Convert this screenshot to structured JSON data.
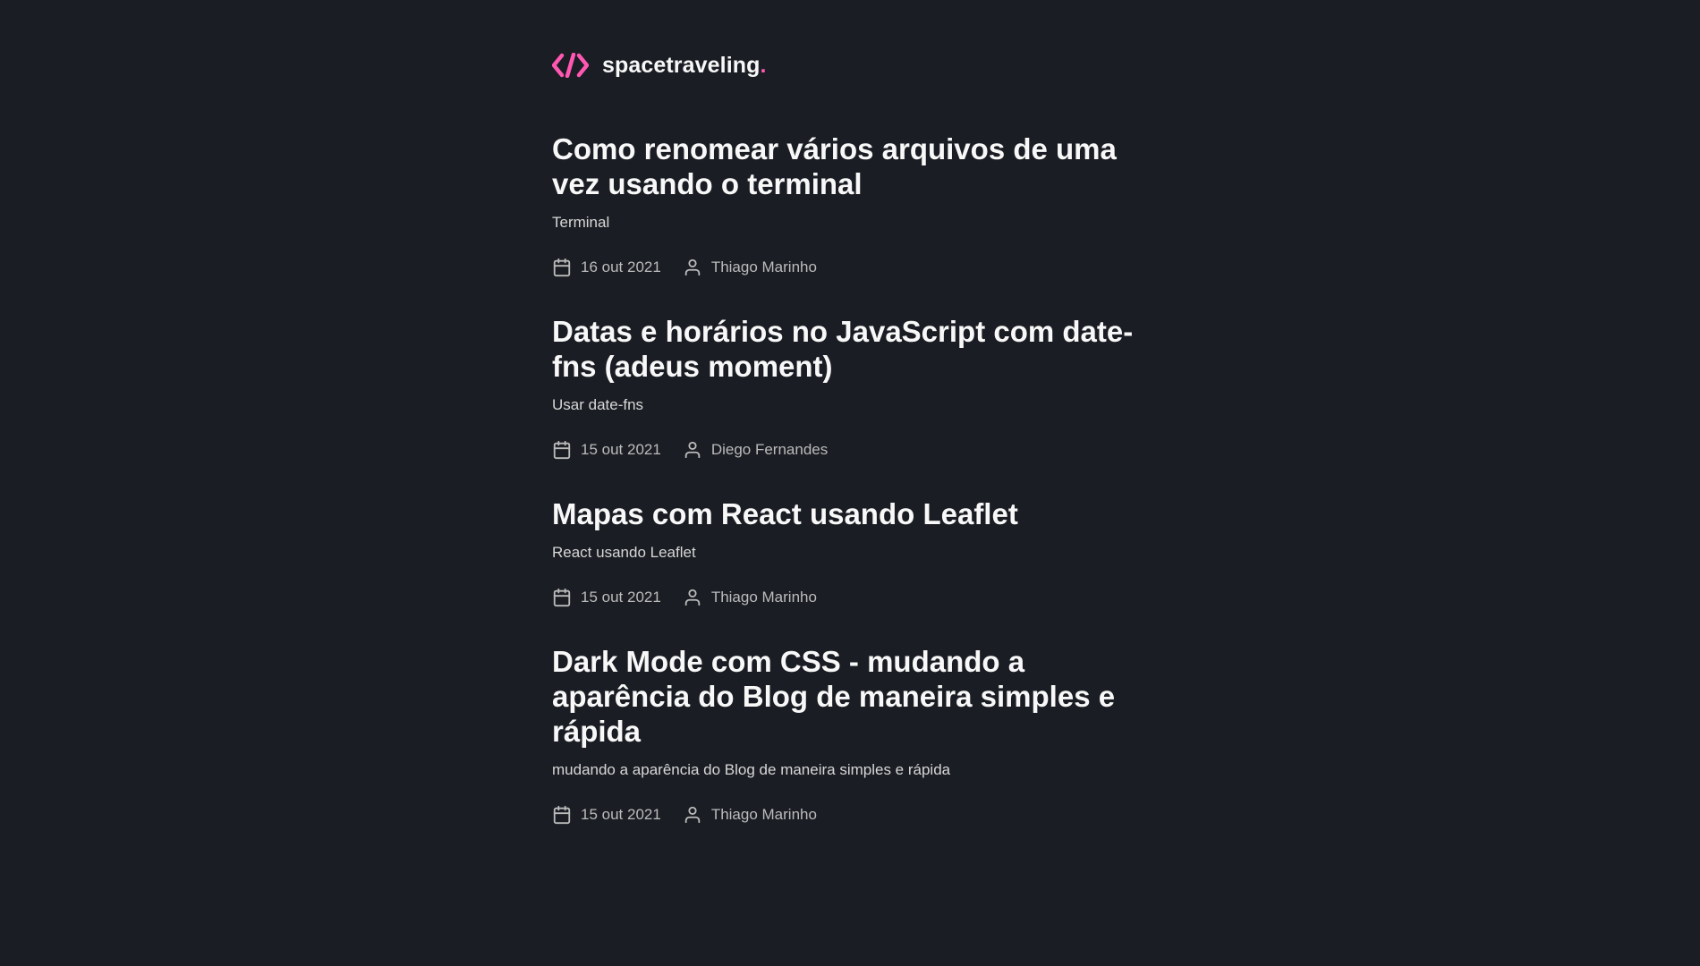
{
  "header": {
    "logo_icon": "code-brackets-icon",
    "brand_name": "spacetraveling",
    "brand_dot": ".",
    "accent_color": "#ff57b2"
  },
  "posts": [
    {
      "title": "Como renomear vários arquivos de uma vez usando o terminal",
      "subtitle": "Terminal",
      "date": "16 out 2021",
      "author": "Thiago Marinho"
    },
    {
      "title": "Datas e horários no JavaScript com date-fns (adeus moment)",
      "subtitle": "Usar date-fns",
      "date": "15 out 2021",
      "author": "Diego Fernandes"
    },
    {
      "title": "Mapas com React usando Leaflet",
      "subtitle": "React usando Leaflet",
      "date": "15 out 2021",
      "author": "Thiago Marinho"
    },
    {
      "title": "Dark Mode com CSS - mudando a aparência do Blog de maneira simples e rápida",
      "subtitle": "mudando a aparência do Blog de maneira simples e rápida",
      "date": "15 out 2021",
      "author": "Thiago Marinho"
    }
  ],
  "icons": {
    "date": "calendar-icon",
    "author": "user-icon"
  }
}
